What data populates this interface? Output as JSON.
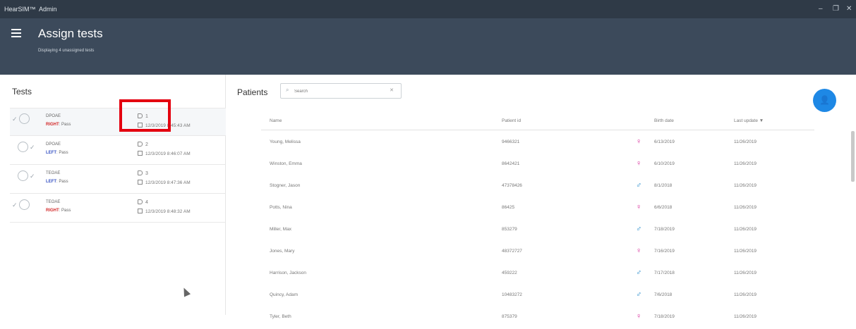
{
  "titlebar": {
    "app": "HearSIM™",
    "user": "Admin",
    "minimize": "–",
    "restore": "❐",
    "close": "✕"
  },
  "header": {
    "title": "Assign tests",
    "subtitle": "Displaying 4 unassigned tests"
  },
  "tests": {
    "title": "Tests",
    "items": [
      {
        "name": "DPOAE",
        "side": "RIGHT",
        "result": ": Pass",
        "id": "1",
        "date": "12/3/2019 8:45:43 AM"
      },
      {
        "name": "DPOAE",
        "side": "LEFT",
        "result": ": Pass",
        "id": "2",
        "date": "12/3/2019 8:46:07 AM"
      },
      {
        "name": "TEOAE",
        "side": "LEFT",
        "result": ": Pass",
        "id": "3",
        "date": "12/3/2019 8:47:36 AM"
      },
      {
        "name": "TEOAE",
        "side": "RIGHT",
        "result": ": Pass",
        "id": "4",
        "date": "12/3/2019 8:48:32 AM"
      }
    ]
  },
  "patients": {
    "title": "Patients",
    "search_placeholder": "Search",
    "columns": {
      "name": "Name",
      "patient_id": "Patient id",
      "birth_date": "Birth date",
      "last_update": "Last update ▼"
    },
    "rows": [
      {
        "name": "Young, Melissa",
        "id": "9466321",
        "gender": "♀",
        "birth": "6/13/2019",
        "updated": "11/26/2019"
      },
      {
        "name": "Winston, Emma",
        "id": "8642421",
        "gender": "♀",
        "birth": "6/10/2019",
        "updated": "11/26/2019"
      },
      {
        "name": "Stogner, Jason",
        "id": "47378426",
        "gender": "♂",
        "birth": "8/1/2018",
        "updated": "11/26/2019"
      },
      {
        "name": "Potts, Nina",
        "id": "86425",
        "gender": "♀",
        "birth": "6/6/2018",
        "updated": "11/26/2019"
      },
      {
        "name": "Miller, Max",
        "id": "853279",
        "gender": "♂",
        "birth": "7/18/2019",
        "updated": "11/26/2019"
      },
      {
        "name": "Jones, Mary",
        "id": "48372727",
        "gender": "♀",
        "birth": "7/16/2019",
        "updated": "11/26/2019"
      },
      {
        "name": "Harrison, Jackson",
        "id": "459222",
        "gender": "♂",
        "birth": "7/17/2018",
        "updated": "11/26/2019"
      },
      {
        "name": "Quincy, Adam",
        "id": "10483272",
        "gender": "♂",
        "birth": "7/6/2018",
        "updated": "11/26/2019"
      },
      {
        "name": "Tyler, Beth",
        "id": "875379",
        "gender": "♀",
        "birth": "7/18/2019",
        "updated": "11/26/2019"
      }
    ]
  },
  "colors": {
    "header": "#3c4a5b",
    "titlebar": "#2f3a47",
    "fab": "#1e88e5",
    "right": "#d32a2a",
    "left": "#3a55c4",
    "female": "#d82d9b",
    "male": "#1f87c9",
    "highlight": "#e4000f"
  },
  "icons": {
    "menu": "hamburger-icon",
    "search": "search-icon",
    "add_patient": "add-person-icon",
    "tag": "tag-icon",
    "calendar": "calendar-icon",
    "ear": "ear-icon"
  }
}
